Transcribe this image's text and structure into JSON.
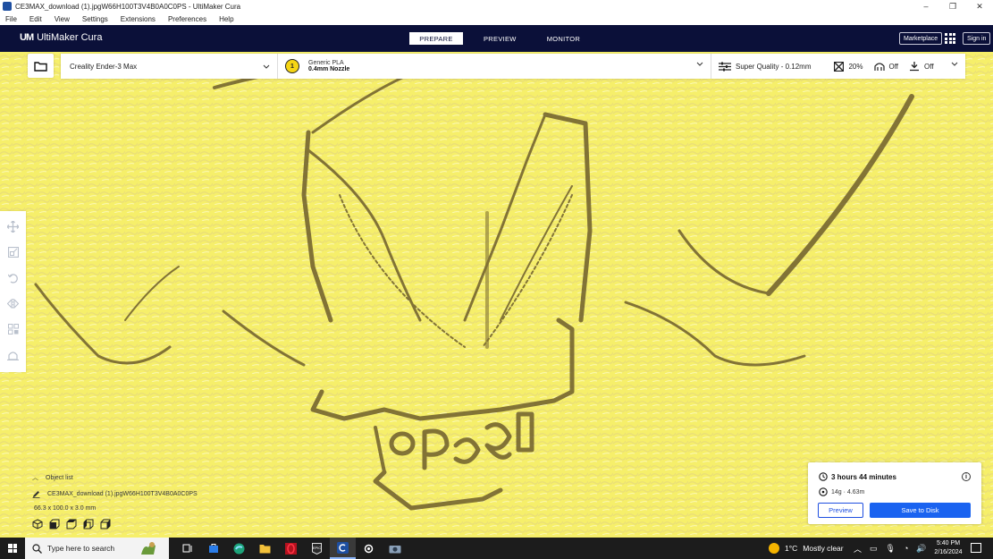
{
  "window": {
    "title": "CE3MAX_download (1).jpgW66H100T3V4B0A0C0PS - UltiMaker Cura",
    "controls": [
      "–",
      "❐",
      "✕"
    ]
  },
  "menu": [
    "File",
    "Edit",
    "View",
    "Settings",
    "Extensions",
    "Preferences",
    "Help"
  ],
  "header": {
    "logo_mark": "UM",
    "app_name": "UltiMaker Cura",
    "tabs": [
      {
        "label": "PREPARE",
        "active": true
      },
      {
        "label": "PREVIEW",
        "active": false
      },
      {
        "label": "MONITOR",
        "active": false
      }
    ],
    "marketplace": "Marketplace",
    "signin": "Sign in"
  },
  "toolbar": {
    "printer": "Creality Ender-3 Max",
    "extruder_number": "1",
    "material": "Generic PLA",
    "nozzle": "0.4mm Nozzle",
    "profile": "Super Quality - 0.12mm",
    "infill": "20%",
    "support": "Off",
    "adhesion": "Off"
  },
  "object_list": {
    "header": "Object list",
    "item_name": "CE3MAX_download (1).jpgW66H100T3V4B0A0C0PS",
    "dimensions": "66.3 x 100.0 x 3.0 mm"
  },
  "print_panel": {
    "time": "3 hours 44 minutes",
    "material_usage": "14g · 4.63m",
    "preview_label": "Preview",
    "save_label": "Save to Disk"
  },
  "taskbar": {
    "search_placeholder": "Type here to search",
    "temperature": "1°C",
    "weather": "Mostly clear",
    "time": "5:40 PM",
    "date": "2/16/2024"
  },
  "colors": {
    "header_bg": "#0b1039",
    "accent_blue": "#1a63f0",
    "model_yellow": "#f6ef6a",
    "taskbar_bg": "#1c1c1c"
  }
}
